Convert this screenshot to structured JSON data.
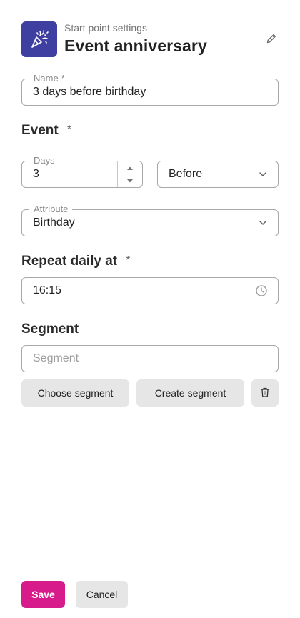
{
  "header": {
    "subtitle": "Start point settings",
    "title": "Event anniversary",
    "icon": "party-popper-icon",
    "edit_icon": "pencil-icon"
  },
  "name_field": {
    "legend": "Name",
    "required_mark": "*",
    "value": "3 days before birthday"
  },
  "event_section": {
    "title": "Event",
    "required_mark": "*",
    "days": {
      "legend": "Days",
      "value": "3"
    },
    "direction": {
      "value": "Before"
    },
    "attribute": {
      "legend": "Attribute",
      "value": "Birthday"
    }
  },
  "repeat_section": {
    "title": "Repeat daily at",
    "required_mark": "*",
    "time": {
      "value": "16:15"
    }
  },
  "segment_section": {
    "title": "Segment",
    "placeholder": "Segment",
    "choose_label": "Choose segment",
    "create_label": "Create segment"
  },
  "footer": {
    "save_label": "Save",
    "cancel_label": "Cancel"
  },
  "colors": {
    "icon_background": "#3f3fa1",
    "primary": "#d81b8a",
    "secondary_button": "#e6e6e6",
    "field_border": "#a8a8a8"
  }
}
